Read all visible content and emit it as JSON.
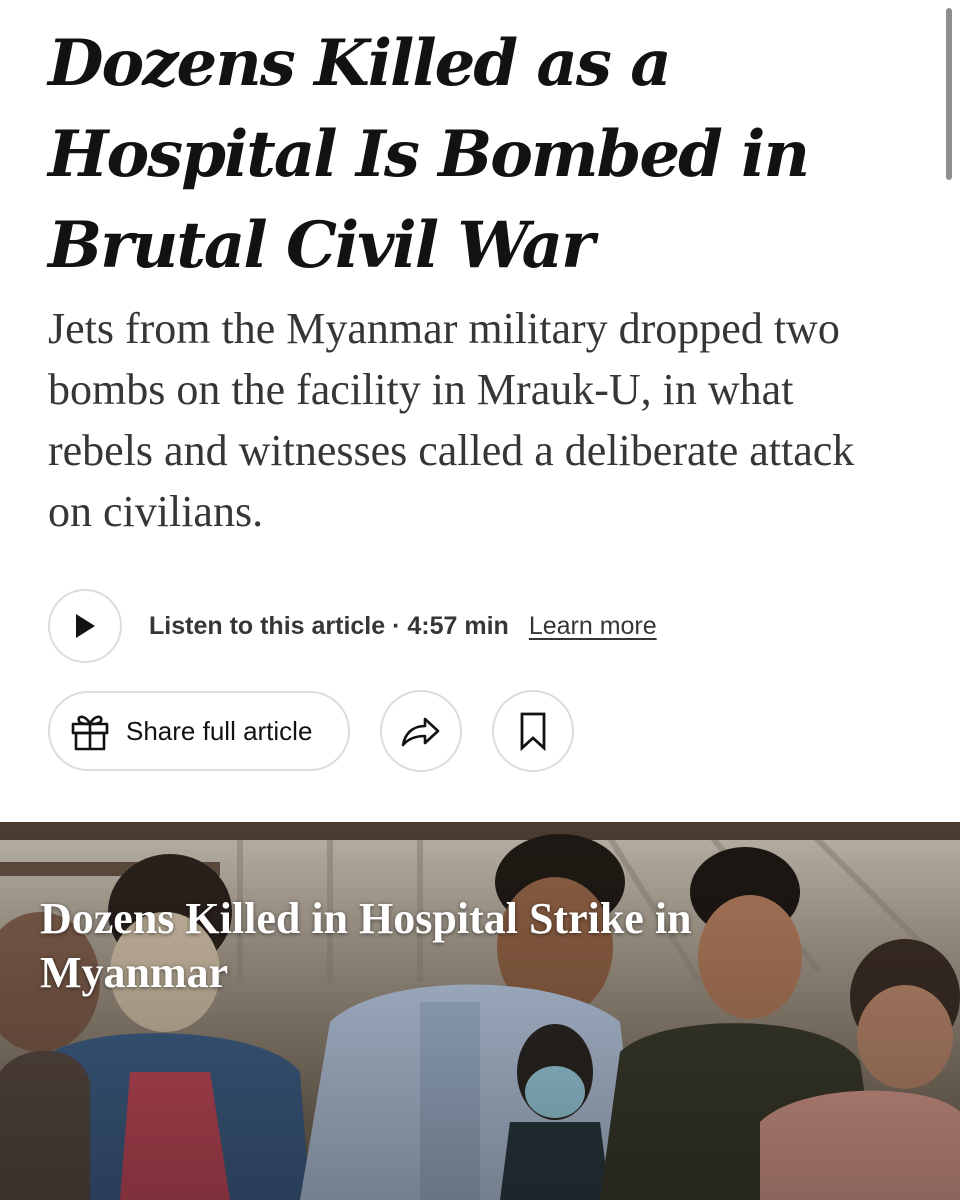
{
  "article": {
    "headline": "Dozens Killed as a Hospital Is Bombed in Brutal Civil War",
    "summary": "Jets from the Myanmar military dropped two bombs on the facility in Mrauk-U, in what rebels and witnesses called a deliberate attack on civilians."
  },
  "audio": {
    "listen_label": "Listen to this article · 4:57 min",
    "learn_more": "Learn more",
    "play_icon": "play-icon"
  },
  "actions": {
    "share_label": "Share full article",
    "gift_icon": "gift-icon",
    "share_icon": "share-arrow-icon",
    "bookmark_icon": "bookmark-icon"
  },
  "video": {
    "title": "Dozens Killed in Hospital Strike in Myanmar"
  },
  "colors": {
    "text": "#121212",
    "summary_text": "#363636",
    "button_border": "#dcdcdc"
  }
}
